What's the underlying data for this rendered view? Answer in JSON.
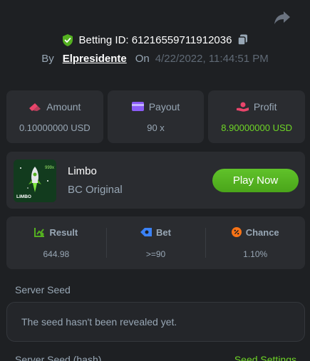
{
  "header": {
    "betting_id_label": "Betting ID: 61216559711912036",
    "by_label": "By",
    "username": "Elpresidente",
    "on_label": "On",
    "date": "4/22/2022, 11:44:51 PM"
  },
  "stats": [
    {
      "label": "Amount",
      "value": "0.10000000 USD",
      "icon": "coin-stack-icon",
      "color": "#e9456b"
    },
    {
      "label": "Payout",
      "value": "90 x",
      "icon": "wallet-card-icon",
      "color": "#8b5cf6"
    },
    {
      "label": "Profit",
      "value": "8.90000000 USD",
      "icon": "hand-coin-icon",
      "color": "#e9456b",
      "value_color": "#6ed526"
    }
  ],
  "game": {
    "name": "Limbo",
    "subtitle": "BC Original",
    "play_label": "Play Now",
    "thumb_text": "LIMBO"
  },
  "results": [
    {
      "label": "Result",
      "value": "644.98",
      "icon": "chart-icon",
      "color": "#54b020"
    },
    {
      "label": "Bet",
      "value": ">=90",
      "icon": "ticket-icon",
      "color": "#3b82f6"
    },
    {
      "label": "Chance",
      "value": "1.10%",
      "icon": "percent-icon",
      "color": "#f97316"
    }
  ],
  "seed": {
    "server_seed_label": "Server Seed",
    "server_seed_value": "The seed hasn't been revealed yet.",
    "hash_label": "Server Seed (hash)",
    "settings_label": "Seed Settings"
  }
}
